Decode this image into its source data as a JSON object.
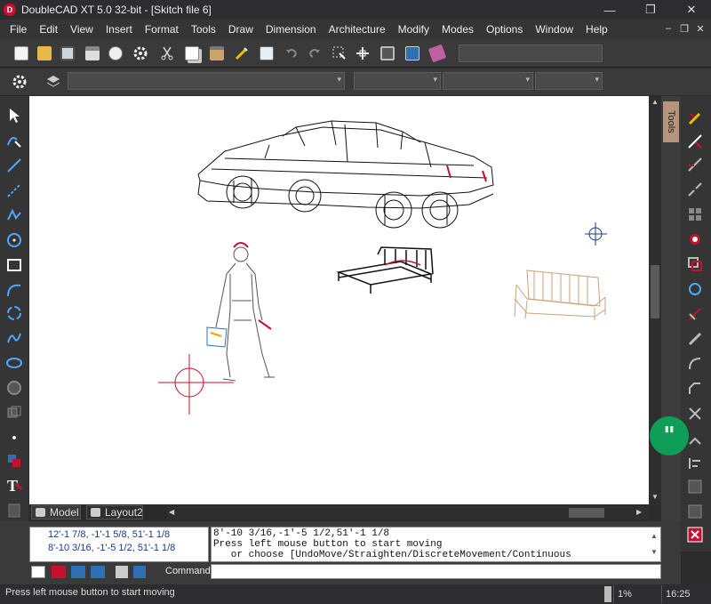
{
  "window": {
    "title": "DoubleCAD XT 5.0 32-bit - [Skitch file 6]",
    "logo": "D",
    "minimize": "—",
    "maximize": "❐",
    "close": "✕"
  },
  "menu": {
    "items": [
      "File",
      "Edit",
      "View",
      "Insert",
      "Format",
      "Tools",
      "Draw",
      "Dimension",
      "Architecture",
      "Modify",
      "Modes",
      "Options",
      "Window",
      "Help"
    ],
    "mdi_minimize": "–",
    "mdi_restore": "❐",
    "mdi_close": "✕"
  },
  "toolbar": {
    "icons": [
      "new-file-icon",
      "open-folder-icon",
      "save-icon",
      "print-icon",
      "print-preview-icon",
      "settings-gear-icon",
      "cut-icon",
      "copy-icon",
      "paste-icon",
      "match-properties-icon",
      "drawing-explorer-icon",
      "undo-icon",
      "redo-icon",
      "select-icon",
      "move-icon",
      "view-icon",
      "calculator-icon",
      "book-icon"
    ]
  },
  "right_panel": {
    "tab_label": "Tools"
  },
  "layout_tabs": {
    "model": "Model",
    "layout2": "Layout2"
  },
  "command": {
    "history": [
      "12'-1 7/8, -1'-1 5/8, 51'-1 1/8",
      "8'-10 3/16, -1'-5 1/2, 51'-1 1/8"
    ],
    "output": [
      "8'-10 3/16,-1'-5 1/2,51'-1 1/8",
      "Press left mouse button to start moving",
      "   or choose [UndoMove/Straighten/DiscreteMovement/Continuous"
    ],
    "prompt_label": "Command:",
    "input_value": ""
  },
  "status": {
    "message": "Press left mouse button to start moving",
    "zoom": "1%",
    "time": "16:25"
  },
  "colors": {
    "hangouts_green": "#0f9d58",
    "accent_red": "#c8102e",
    "bench_tan": "#c9a27a"
  },
  "canvas_objects": [
    "car-3d-wireframe",
    "woman-figure",
    "bed-frame",
    "garden-bench",
    "snap-cursor-red",
    "small-cursor-marker"
  ]
}
